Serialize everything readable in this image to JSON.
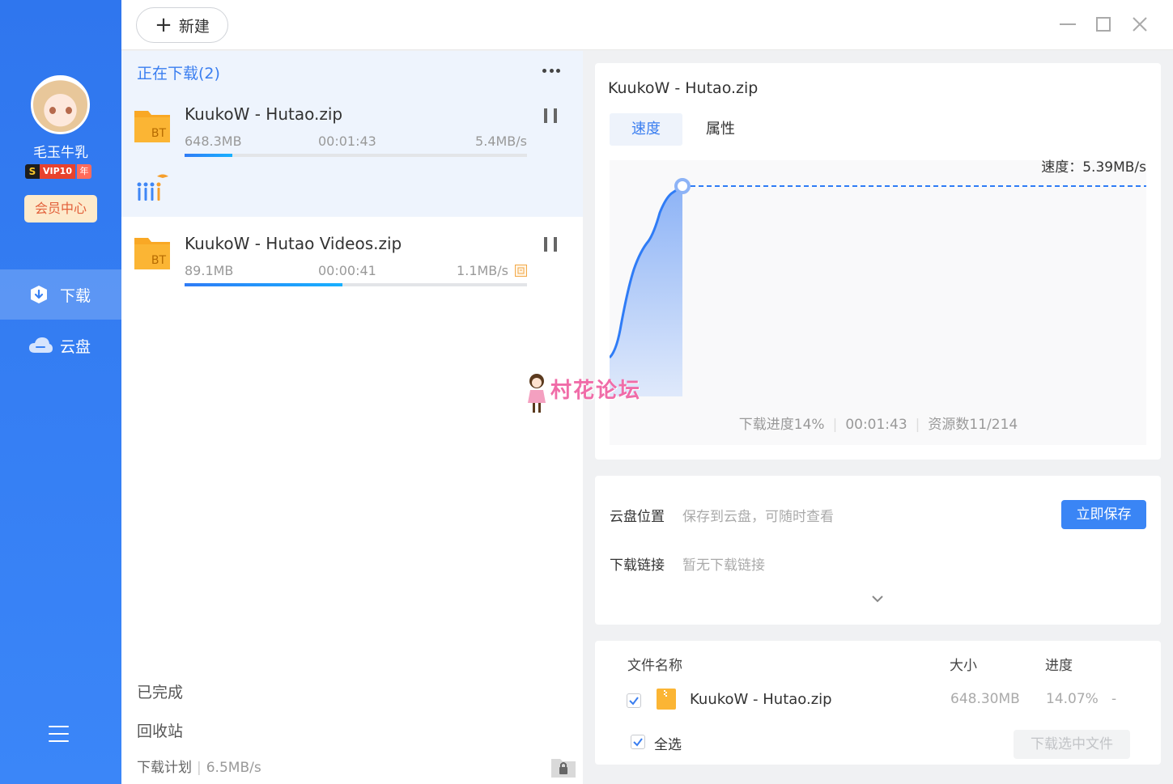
{
  "sidebar": {
    "username": "毛玉牛乳",
    "vip": {
      "s": "S",
      "level": "VIP10",
      "year": "年"
    },
    "member_center": "会员中心",
    "nav": [
      {
        "label": "下载",
        "icon": "download-icon",
        "active": true
      },
      {
        "label": "云盘",
        "icon": "cloud-icon",
        "active": false
      }
    ]
  },
  "topbar": {
    "new_label": "新建"
  },
  "list": {
    "header": "正在下载(2)",
    "tasks": [
      {
        "name": "KuukoW - Hutao.zip",
        "size": "648.3MB",
        "time": "00:01:43",
        "speed": "5.4MB/s",
        "progress": 0.14,
        "icon": "bt-folder-icon"
      },
      {
        "name": "KuukoW - Hutao Videos.zip",
        "size": "89.1MB",
        "time": "00:00:41",
        "speed": "1.1MB/s",
        "progress": 0.46,
        "icon": "bt-folder-icon"
      }
    ],
    "completed": "已完成",
    "recycle": "回收站",
    "plan_label": "下载计划",
    "plan_speed": "6.5MB/s"
  },
  "detail": {
    "title": "KuukoW - Hutao.zip",
    "tabs": [
      "速度",
      "属性"
    ],
    "speed_text": "速度：5.39MB/s",
    "stats": {
      "progress": "下载进度14%",
      "time": "00:01:43",
      "sources": "资源数11/214"
    }
  },
  "cloud": {
    "location_label": "云盘位置",
    "location_value": "保存到云盘，可随时查看",
    "save_button": "立即保存",
    "link_label": "下载链接",
    "link_value": "暂无下载链接"
  },
  "files": {
    "headers": {
      "name": "文件名称",
      "size": "大小",
      "progress": "进度"
    },
    "rows": [
      {
        "name": "KuukoW - Hutao.zip",
        "size": "648.30MB",
        "progress": "14.07%",
        "extra": "-",
        "checked": true
      }
    ],
    "select_all": "全选",
    "download_selected": "下载选中文件"
  },
  "watermark": "村花论坛",
  "colors": {
    "sidebar": "#3b86f8",
    "accent": "#3a7ef0",
    "member_bg": "#fdeacb",
    "member_text": "#e2603a"
  }
}
